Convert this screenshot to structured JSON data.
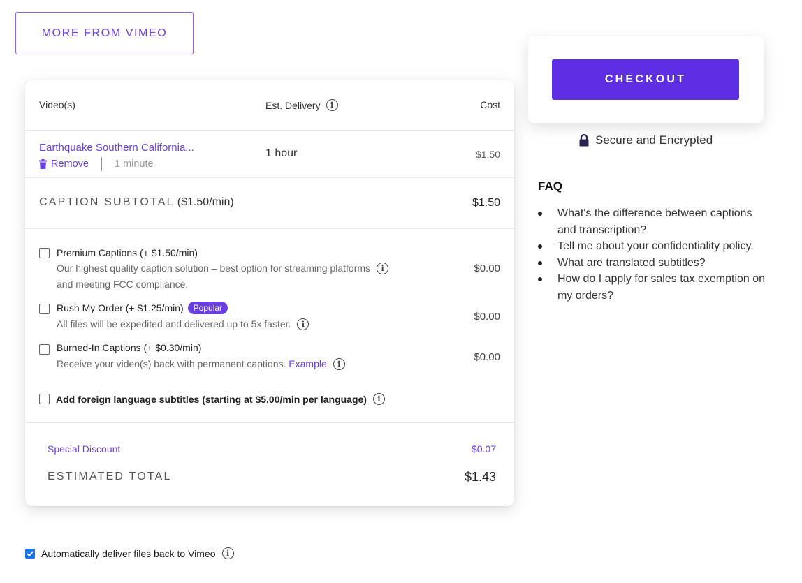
{
  "top_button": {
    "label": "MORE FROM VIMEO"
  },
  "table": {
    "headers": {
      "videos": "Video(s)",
      "delivery": "Est. Delivery",
      "cost": "Cost"
    },
    "item": {
      "title": "Earthquake Southern California...",
      "remove_label": "Remove",
      "duration": "1 minute",
      "delivery": "1 hour",
      "cost": "$1.50"
    },
    "subtotal": {
      "label": "CAPTION SUBTOTAL",
      "rate": "($1.50/min)",
      "amount": "$1.50"
    }
  },
  "options": [
    {
      "name": "Premium Captions (+ $1.50/min)",
      "desc_line1": "Our highest quality caption solution – best option for streaming platforms",
      "desc_line2": "and meeting FCC compliance.",
      "price": "$0.00",
      "checked": false
    },
    {
      "name": "Rush My Order (+ $1.25/min)",
      "badge": "Popular",
      "desc": "All files will be expedited and delivered up to 5x faster.",
      "price": "$0.00",
      "checked": false
    },
    {
      "name": "Burned-In Captions (+ $0.30/min)",
      "desc": "Receive your video(s) back with permanent captions.",
      "link": "Example",
      "price": "$0.00",
      "checked": false
    }
  ],
  "foreign": {
    "label": "Add foreign language subtitles (starting at $5.00/min per language)",
    "checked": false
  },
  "discount": {
    "label": "Special Discount",
    "amount": "$0.07"
  },
  "total": {
    "label": "ESTIMATED TOTAL",
    "amount": "$1.43"
  },
  "checkout": {
    "label": "CHECKOUT",
    "secure_text": "Secure and Encrypted"
  },
  "faq": {
    "title": "FAQ",
    "items": [
      "What's the difference between captions and transcription?",
      "Tell me about your confidentiality policy.",
      "What are translated subtitles?",
      "How do I apply for sales tax exemption on my orders?"
    ]
  },
  "auto_deliver": {
    "label": "Automatically deliver files back to Vimeo",
    "checked": true
  },
  "colors": {
    "accent": "#6a3fe0",
    "checkout": "#5e2ee3",
    "checkbox_checked": "#1a73e8"
  },
  "icons": {
    "info": "info-icon",
    "trash": "trash-icon",
    "lock": "lock-icon",
    "check": "check-icon"
  }
}
